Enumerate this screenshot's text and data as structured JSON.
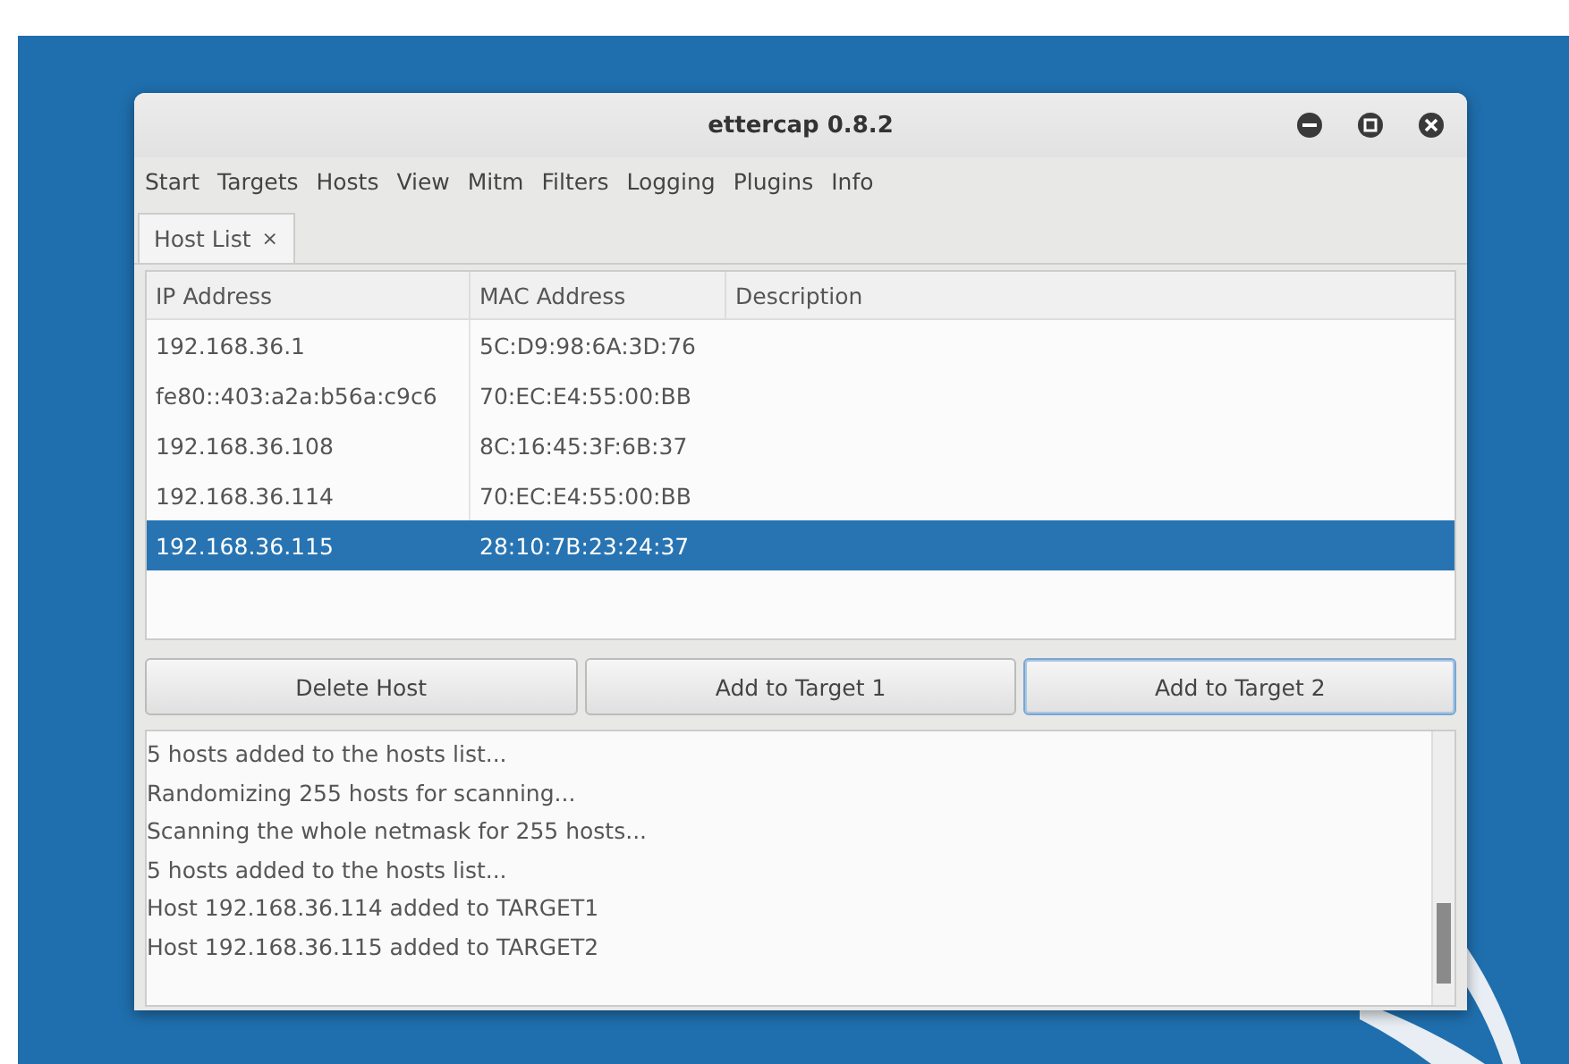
{
  "window": {
    "title": "ettercap 0.8.2"
  },
  "menu": [
    "Start",
    "Targets",
    "Hosts",
    "View",
    "Mitm",
    "Filters",
    "Logging",
    "Plugins",
    "Info"
  ],
  "tabs": [
    {
      "label": "Host List",
      "close": "×",
      "selected": true
    }
  ],
  "table": {
    "columns": [
      "IP Address",
      "MAC Address",
      "Description"
    ],
    "rows": [
      {
        "ip": "192.168.36.1",
        "mac": "5C:D9:98:6A:3D:76",
        "selected": false
      },
      {
        "ip": "fe80::403:a2a:b56a:c9c6",
        "mac": "70:EC:E4:55:00:BB",
        "selected": false
      },
      {
        "ip": "192.168.36.108",
        "mac": "8C:16:45:3F:6B:37",
        "selected": false
      },
      {
        "ip": "192.168.36.114",
        "mac": "70:EC:E4:55:00:BB",
        "selected": false
      },
      {
        "ip": "192.168.36.115",
        "mac": "28:10:7B:23:24:37",
        "selected": true
      }
    ]
  },
  "buttons": [
    {
      "label": "Delete Host",
      "focused": false
    },
    {
      "label": "Add to Target 1",
      "focused": false
    },
    {
      "label": "Add to Target 2",
      "focused": true
    }
  ],
  "log": [
    "5 hosts added to the hosts list...",
    "Randomizing 255 hosts for scanning...",
    "Scanning the whole netmask for 255 hosts...",
    "5 hosts added to the hosts list...",
    "Host 192.168.36.114 added to TARGET1",
    "Host 192.168.36.115 added to TARGET2"
  ]
}
